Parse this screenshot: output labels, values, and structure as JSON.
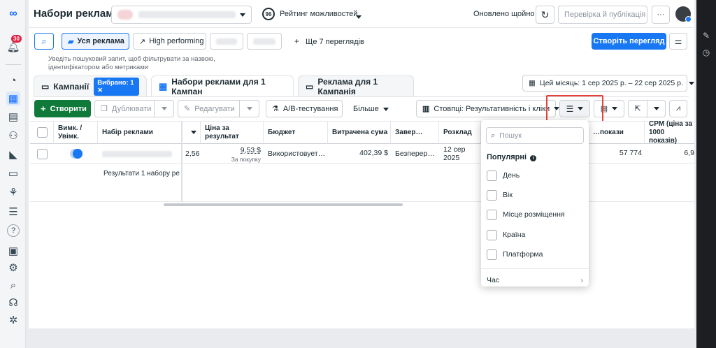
{
  "app": {
    "title": "Набори реклами",
    "account_blurred": "",
    "opportunity_score": "96",
    "opportunity_label": "Рейтинг можливостей",
    "updated": "Оновлено щойно",
    "review_publish": "Перевірка й публікація",
    "more": "···",
    "notification_count": "30"
  },
  "filters": {
    "all_ads": "Уся реклама",
    "high_performing": "High performing",
    "more_views": "Ще 7 переглядів",
    "create_view": "Створіть перегляд",
    "search_placeholder": "Уведіть пошуковий запит, щоб фільтрувати за назвою, ідентифікатором або метриками"
  },
  "tabs": {
    "campaigns": "Кампанії",
    "selected_badge": "Вибрано: 1",
    "adsets": "Набори реклами для 1 Кампан",
    "ads": "Реклама для 1 Кампанія",
    "date_range": "Цей місяць: 1 сер 2025 р. – 22 сер 2025 р."
  },
  "toolbar": {
    "create": "Створити",
    "duplicate": "Дублювати",
    "edit": "Редагувати",
    "ab_test": "A/B-тестування",
    "more": "Більше",
    "columns": "Стовпці: Результативність і кліки"
  },
  "table": {
    "headers": {
      "toggle": "Вимк. / Увімк.",
      "adset": "Набір реклами",
      "cost_per_result": "Ціна за результат",
      "budget": "Бюджет",
      "spent": "Витрачена сума",
      "ends": "Завер…",
      "schedule": "Розклад",
      "impressions": "…покази",
      "cpm": "CPM (ціна за 1000 показів)"
    },
    "row": {
      "results_fragment": "2,56",
      "cost_per_result": "9,53 $",
      "cost_per_result_sub": "За покупку",
      "budget": "Використовует…",
      "spent": "402,39 $",
      "ends": "Безперер…",
      "schedule": "12 сер 2025",
      "impressions": "57 774",
      "cpm": "6,9"
    },
    "summary": "Результати 1 набору ре"
  },
  "breakdown_dropdown": {
    "search_placeholder": "Пошук",
    "section_title": "Популярні",
    "options": [
      "День",
      "Вік",
      "Місце розміщення",
      "Країна",
      "Платформа"
    ],
    "footer": "Час"
  },
  "colors": {
    "brand": "#1877f2",
    "create_green": "#0f7a3a",
    "highlight_red": "#e5403a",
    "notification_red": "#e41e3f"
  }
}
